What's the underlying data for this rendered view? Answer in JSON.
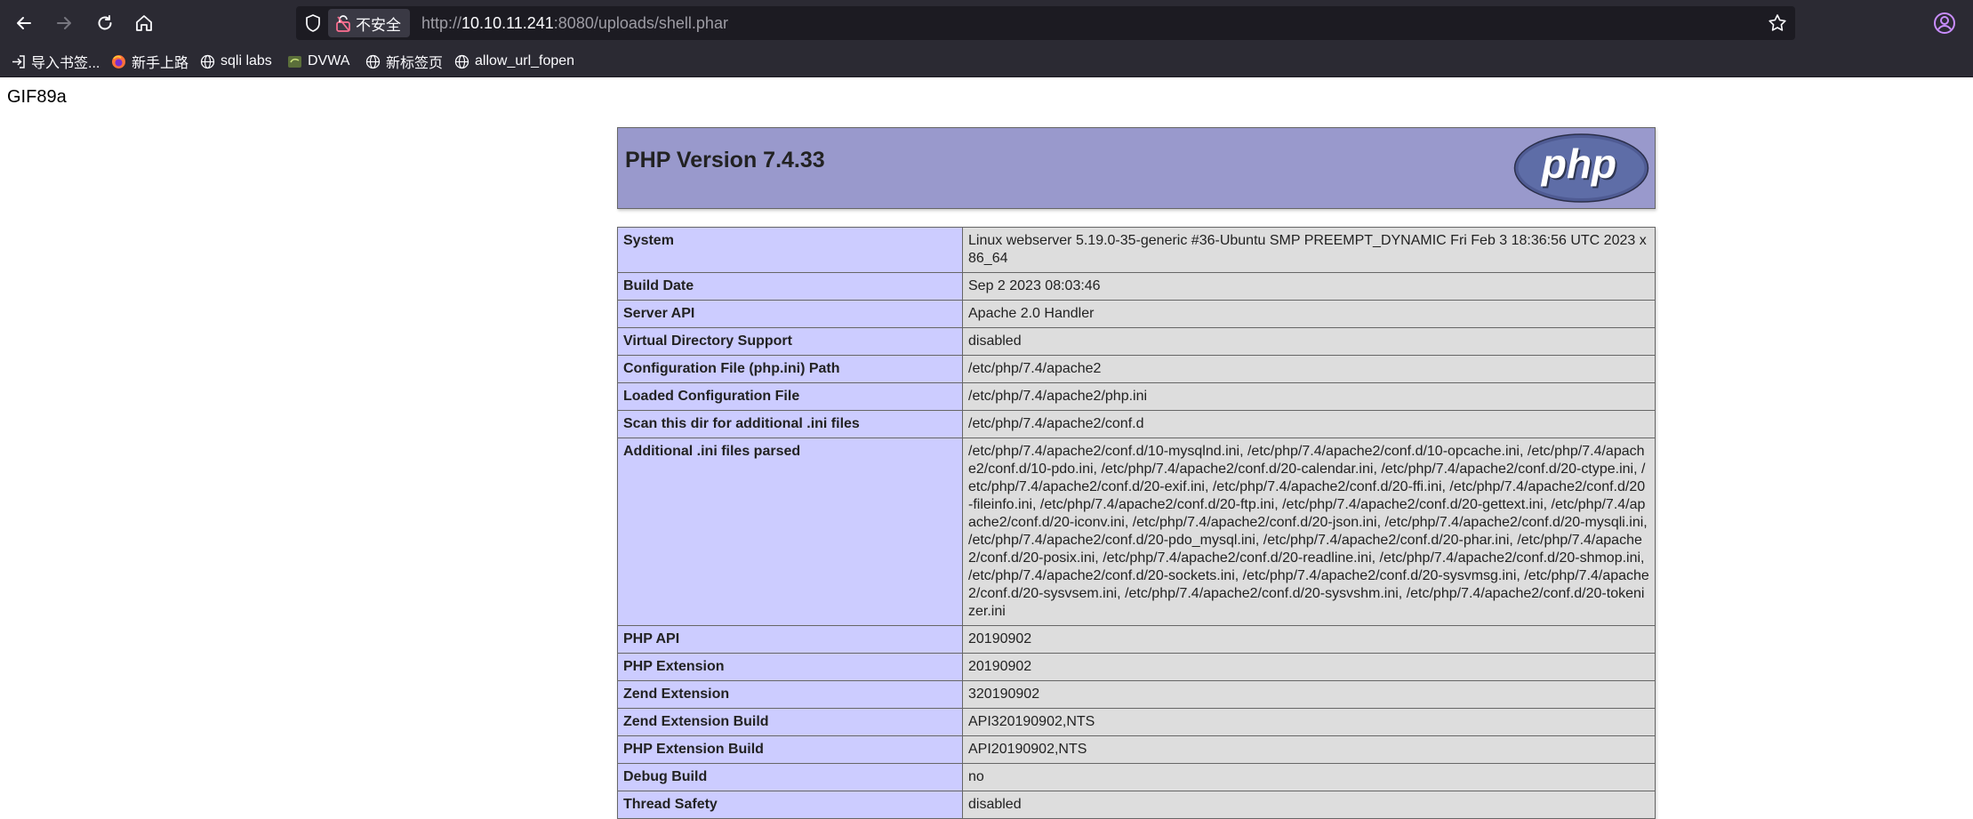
{
  "browser": {
    "security_label": "不安全",
    "url_prefix": "http://",
    "url_host": "10.10.11.241",
    "url_rest": ":8080/uploads/shell.phar",
    "accent_color": "#2b2a33"
  },
  "bookmarks": [
    {
      "label": "导入书签...",
      "icon": "import-icon"
    },
    {
      "label": "新手上路",
      "icon": "firefox-icon"
    },
    {
      "label": "sqli labs",
      "icon": "globe-icon"
    },
    {
      "label": "DVWA",
      "icon": "dvwa-icon"
    },
    {
      "label": "新标签页",
      "icon": "globe-icon"
    },
    {
      "label": "allow_url_fopen",
      "icon": "globe-icon"
    }
  ],
  "page": {
    "gif_header": "GIF89a",
    "php_version_title": "PHP Version 7.4.33",
    "logo_text": "php",
    "rows": [
      {
        "key": "System",
        "value": "Linux webserver 5.19.0-35-generic #36-Ubuntu SMP PREEMPT_DYNAMIC Fri Feb 3 18:36:56 UTC 2023 x86_64"
      },
      {
        "key": "Build Date",
        "value": "Sep 2 2023 08:03:46"
      },
      {
        "key": "Server API",
        "value": "Apache 2.0 Handler"
      },
      {
        "key": "Virtual Directory Support",
        "value": "disabled"
      },
      {
        "key": "Configuration File (php.ini) Path",
        "value": "/etc/php/7.4/apache2"
      },
      {
        "key": "Loaded Configuration File",
        "value": "/etc/php/7.4/apache2/php.ini"
      },
      {
        "key": "Scan this dir for additional .ini files",
        "value": "/etc/php/7.4/apache2/conf.d"
      },
      {
        "key": "Additional .ini files parsed",
        "value": "/etc/php/7.4/apache2/conf.d/10-mysqlnd.ini, /etc/php/7.4/apache2/conf.d/10-opcache.ini, /etc/php/7.4/apache2/conf.d/10-pdo.ini, /etc/php/7.4/apache2/conf.d/20-calendar.ini, /etc/php/7.4/apache2/conf.d/20-ctype.ini, /etc/php/7.4/apache2/conf.d/20-exif.ini, /etc/php/7.4/apache2/conf.d/20-ffi.ini, /etc/php/7.4/apache2/conf.d/20-fileinfo.ini, /etc/php/7.4/apache2/conf.d/20-ftp.ini, /etc/php/7.4/apache2/conf.d/20-gettext.ini, /etc/php/7.4/apache2/conf.d/20-iconv.ini, /etc/php/7.4/apache2/conf.d/20-json.ini, /etc/php/7.4/apache2/conf.d/20-mysqli.ini, /etc/php/7.4/apache2/conf.d/20-pdo_mysql.ini, /etc/php/7.4/apache2/conf.d/20-phar.ini, /etc/php/7.4/apache2/conf.d/20-posix.ini, /etc/php/7.4/apache2/conf.d/20-readline.ini, /etc/php/7.4/apache2/conf.d/20-shmop.ini, /etc/php/7.4/apache2/conf.d/20-sockets.ini, /etc/php/7.4/apache2/conf.d/20-sysvmsg.ini, /etc/php/7.4/apache2/conf.d/20-sysvsem.ini, /etc/php/7.4/apache2/conf.d/20-sysvshm.ini, /etc/php/7.4/apache2/conf.d/20-tokenizer.ini"
      },
      {
        "key": "PHP API",
        "value": "20190902"
      },
      {
        "key": "PHP Extension",
        "value": "20190902"
      },
      {
        "key": "Zend Extension",
        "value": "320190902"
      },
      {
        "key": "Zend Extension Build",
        "value": "API320190902,NTS"
      },
      {
        "key": "PHP Extension Build",
        "value": "API20190902,NTS"
      },
      {
        "key": "Debug Build",
        "value": "no"
      },
      {
        "key": "Thread Safety",
        "value": "disabled"
      }
    ]
  }
}
